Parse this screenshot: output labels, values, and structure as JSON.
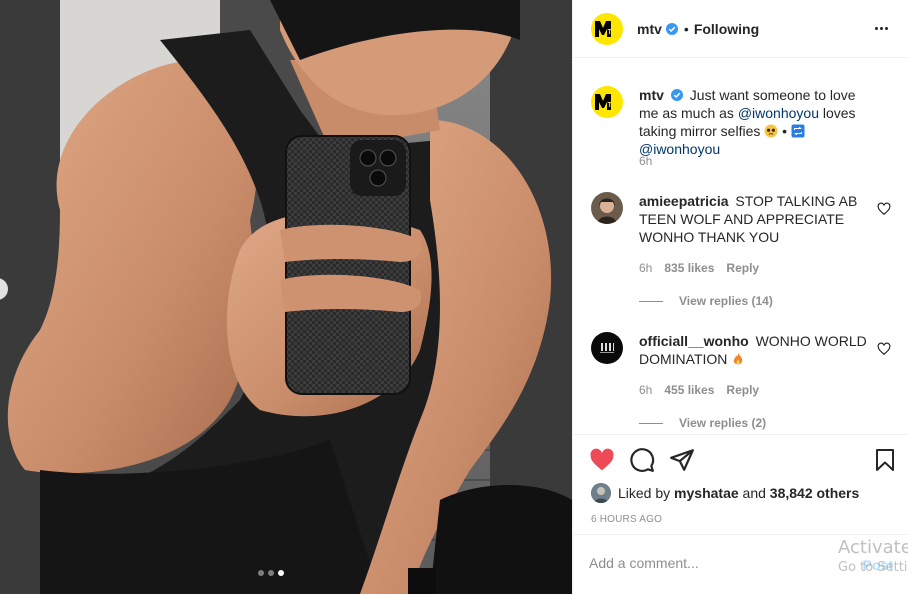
{
  "post": {
    "username": "mtv",
    "follow_status": "Following",
    "separator": "•"
  },
  "caption": {
    "username": "mtv",
    "text_before": "Just want someone to love me as much as",
    "mention": "@iwonhoyou",
    "text_after": "loves taking mirror selfies",
    "bullet": "•",
    "mention2": "@iwonhoyou",
    "time": "6h"
  },
  "comments": [
    {
      "username": "amieepatricia",
      "text": "STOP TALKING AB TEEN WOLF AND APPRECIATE WONHO THANK YOU",
      "time": "6h",
      "likes": "835 likes",
      "reply": "Reply",
      "view_replies": "View replies (14)"
    },
    {
      "username": "officiall__wonho",
      "text": "WONHO WORLD DOMINATION",
      "time": "6h",
      "likes": "455 likes",
      "reply": "Reply",
      "view_replies": "View replies (2)"
    }
  ],
  "likes_summary": {
    "prefix": "Liked by",
    "user": "myshatae",
    "and": "and",
    "others": "38,842 others"
  },
  "posted_ago": "6 HOURS AGO",
  "add_comment": {
    "placeholder": "Add a comment...",
    "post_label": "Post"
  },
  "carousel": {
    "slide_count": 3,
    "active_index": 2
  },
  "icons": {
    "like": "heart-filled-icon",
    "comment": "comment-bubble-icon",
    "share": "paper-plane-icon",
    "save": "bookmark-icon",
    "options": "more-dots-icon",
    "verified": "verified-badge-icon"
  },
  "colors": {
    "like_red": "#ed4956",
    "verified_blue": "#3897f0",
    "link_blue": "#00376b",
    "mtv_yellow": "#ffe600"
  },
  "watermark": {
    "line1": "Activate",
    "line2": "Go to Setti"
  }
}
